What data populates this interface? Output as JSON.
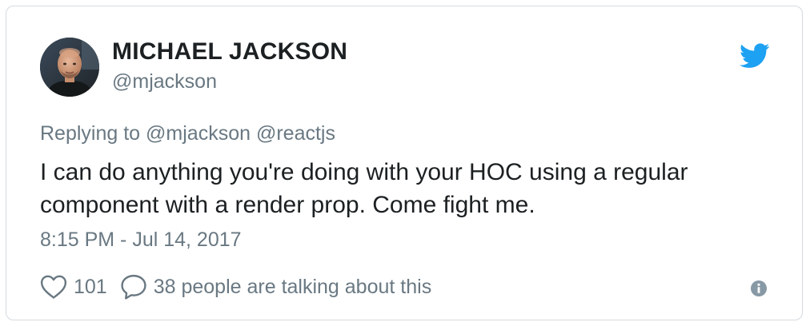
{
  "author": {
    "name": "MICHAEL JACKSON",
    "handle": "@mjackson",
    "avatar_icon": "user-avatar-photo"
  },
  "reply": {
    "prefix": "Replying to",
    "mentions": [
      "@mjackson",
      "@reactjs"
    ]
  },
  "tweet": {
    "text_line1": "I can do anything you're doing with your HOC using a regular",
    "text_line2": "component with a render prop. Come fight me.",
    "timestamp": "8:15 PM - Jul 14, 2017"
  },
  "actions": {
    "like_icon": "heart-icon",
    "like_count": "101",
    "conversation_icon": "speech-bubble-icon",
    "conversation_text": "38 people are talking about this",
    "info_icon": "info-icon"
  },
  "colors": {
    "text_primary": "#1c2022",
    "text_secondary": "#697882",
    "twitter_blue": "#1da1f2",
    "border": "#d5dade",
    "info_gray": "#8899a6"
  }
}
